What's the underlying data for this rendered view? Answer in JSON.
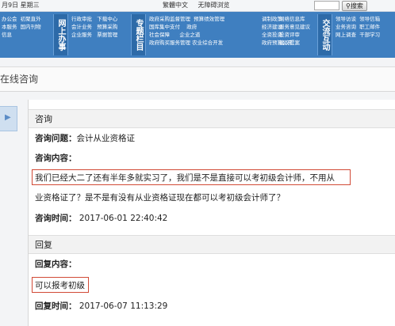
{
  "topbar": {
    "date": "月9日  星期三",
    "lang": "繁體中文",
    "accessible": "无障碍浏览",
    "search_label": "搜索"
  },
  "nav": {
    "col1": [
      "办公会",
      "初聚直外",
      "本服务",
      "国内刊物",
      "信息"
    ],
    "head1": "网上办事",
    "col2": [
      "行政审批",
      "下载中心",
      "会计业务",
      "预算采购",
      "企业服务",
      "票据管理"
    ],
    "head2": "专题栏目",
    "col3": [
      "政府采购监督管理",
      "预算绩效管理",
      "国库集中支付",
      "政府",
      "社会保障",
      "企业之道",
      "政府购买服务管理",
      "农业综合开发"
    ],
    "col4": [
      "调制政策",
      "经济建设",
      "全资投资",
      "政府预算公开"
    ],
    "col5": [
      "网络信息库",
      "服务意见建议",
      "投资评审",
      "建议提案"
    ],
    "head3": "交流互动",
    "col6": [
      "领导访谈",
      "领导信箱",
      "业务咨询",
      "职工邮件",
      "网上调查",
      "干部学习"
    ]
  },
  "title": "在线咨询",
  "consult": {
    "section": "咨询",
    "question_label": "咨询问题：",
    "question_value": "会计从业资格证",
    "content_label": "咨询内容：",
    "content_line1_boxed": "我们已经大二了还有半年多就实习了，我们是不是直接可以考初级会计师，",
    "content_line1_rest": "不用从",
    "content_line2": "业资格证了？是不是有没有从业资格证现在都可以考初级会计师了？",
    "time_label": "咨询时间：",
    "time_value": "2017-06-01 22:40:42"
  },
  "reply": {
    "section": "回复",
    "content_label": "回复内容：",
    "content_value": "可以报考初级",
    "time_label": "回复时间：",
    "time_value": "2017-06-07 11:13:29"
  }
}
